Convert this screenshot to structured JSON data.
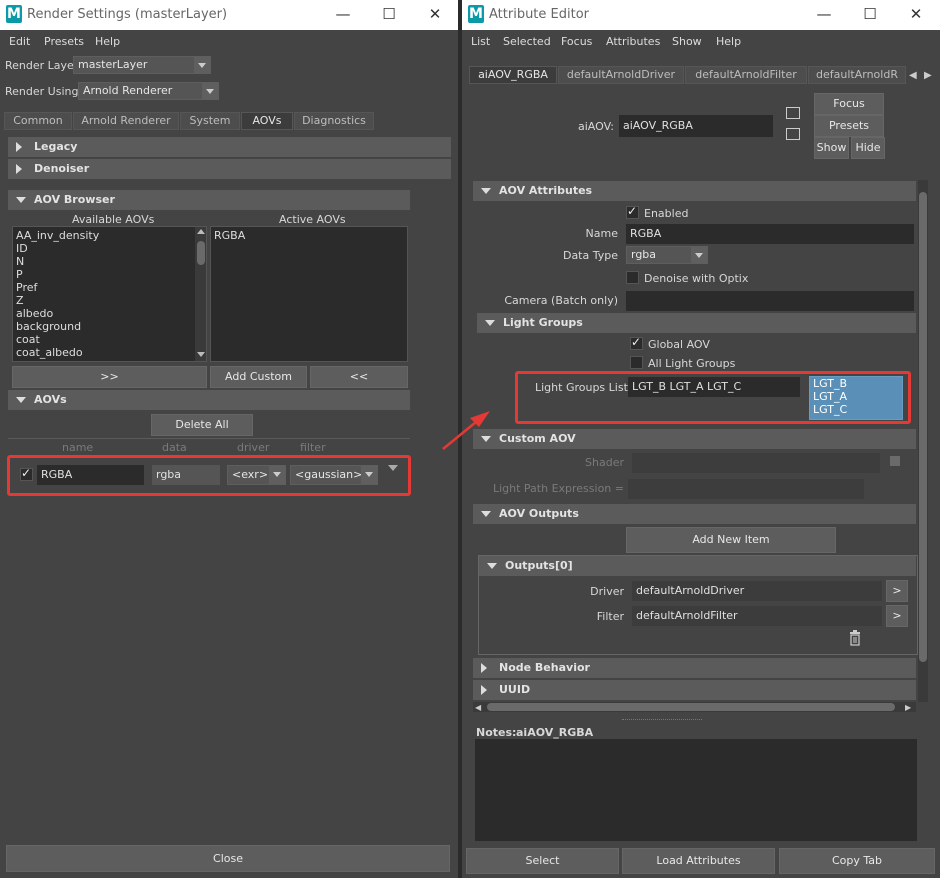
{
  "render_settings": {
    "title": "Render Settings (masterLayer)",
    "menu": [
      "Edit",
      "Presets",
      "Help"
    ],
    "render_layer_label": "Render Layer",
    "render_layer_value": "masterLayer",
    "render_using_label": "Render Using",
    "render_using_value": "Arnold Renderer",
    "tabs": [
      "Common",
      "Arnold Renderer",
      "System",
      "AOVs",
      "Diagnostics"
    ],
    "active_tab": "AOVs",
    "sections": {
      "legacy": "Legacy",
      "denoiser": "Denoiser",
      "aov_browser": "AOV Browser",
      "aovs": "AOVs"
    },
    "available_aovs_header": "Available AOVs",
    "active_aovs_header": "Active AOVs",
    "available_aovs": [
      "AA_inv_density",
      "ID",
      "N",
      "P",
      "Pref",
      "Z",
      "albedo",
      "background",
      "coat",
      "coat_albedo"
    ],
    "active_aovs": [
      "RGBA"
    ],
    "move_right_label": ">>",
    "add_custom_label": "Add Custom",
    "move_left_label": "<<",
    "delete_all_label": "Delete All",
    "aov_columns": [
      "name",
      "data",
      "driver",
      "filter"
    ],
    "aov_row": {
      "enabled": true,
      "name": "RGBA",
      "data": "rgba",
      "driver": "<exr>",
      "filter": "<gaussian>"
    },
    "close_label": "Close"
  },
  "attribute_editor": {
    "title": "Attribute Editor",
    "menu": [
      "List",
      "Selected",
      "Focus",
      "Attributes",
      "Show",
      "Help"
    ],
    "tabs": [
      "aiAOV_RGBA",
      "defaultArnoldDriver",
      "defaultArnoldFilter",
      "defaultArnoldR"
    ],
    "node_type_label": "aiAOV:",
    "node_name": "aiAOV_RGBA",
    "focus_label": "Focus",
    "presets_label": "Presets",
    "show_label": "Show",
    "hide_label": "Hide",
    "aov_attributes": {
      "header": "AOV Attributes",
      "enabled_label": "Enabled",
      "enabled": true,
      "name_label": "Name",
      "name_value": "RGBA",
      "data_type_label": "Data Type",
      "data_type_value": "rgba",
      "denoise_label": "Denoise with Optix",
      "denoise": false,
      "camera_label": "Camera (Batch only)",
      "camera_value": ""
    },
    "light_groups": {
      "header": "Light Groups",
      "global_aov_label": "Global AOV",
      "global_aov": true,
      "all_light_groups_label": "All Light Groups",
      "all_light_groups": false,
      "list_label": "Light Groups List",
      "list_value": "LGT_B LGT_A LGT_C",
      "items": [
        "LGT_B",
        "LGT_A",
        "LGT_C"
      ]
    },
    "custom_aov": {
      "header": "Custom AOV",
      "shader_label": "Shader",
      "lpe_label": "Light Path Expression ="
    },
    "aov_outputs": {
      "header": "AOV Outputs",
      "add_new_item_label": "Add New Item",
      "outputs_header": "Outputs[0]",
      "driver_label": "Driver",
      "driver_value": "defaultArnoldDriver",
      "filter_label": "Filter",
      "filter_value": "defaultArnoldFilter",
      "goto_label": ">"
    },
    "node_behavior_header": "Node Behavior",
    "uuid_header": "UUID",
    "notes_label": "Notes:",
    "notes_node": "aiAOV_RGBA",
    "bottom_buttons": [
      "Select",
      "Load Attributes",
      "Copy Tab"
    ]
  },
  "colors": {
    "highlight_red": "#e53935",
    "selection_blue": "#5a8fb8",
    "maya_teal": "#0a9aa8"
  }
}
